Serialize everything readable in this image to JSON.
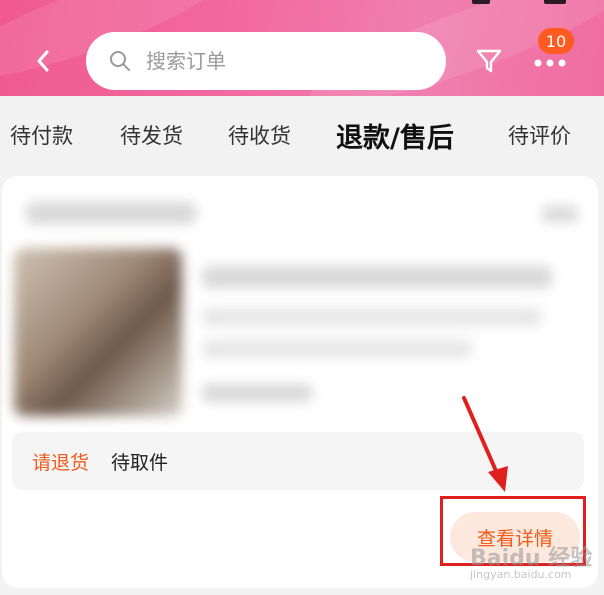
{
  "header": {
    "search_placeholder": "搜索订单",
    "badge_count": "10"
  },
  "tabs": [
    {
      "label": "待付款"
    },
    {
      "label": "待发货"
    },
    {
      "label": "待收货"
    },
    {
      "label": "退款/售后"
    },
    {
      "label": "待评价"
    }
  ],
  "order": {
    "return_status": "请退货",
    "pickup_status": "待取件",
    "detail_button": "查看详情"
  },
  "watermark": {
    "brand": "Baidu 经验",
    "site": "jingyan.baidu.com"
  },
  "colors": {
    "accent": "#f05a1a",
    "header_pink": "#f26aa0",
    "highlight_red": "#e0201f"
  }
}
